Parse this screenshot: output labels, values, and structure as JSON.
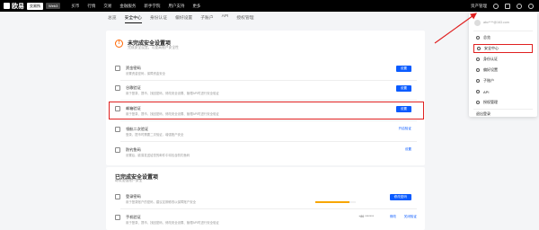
{
  "topbar": {
    "brand": "欧易",
    "pill_active": "交易所",
    "pill_inactive": "Web3",
    "nav": [
      "买币",
      "行情",
      "交易",
      "金融服务",
      "新手学院",
      "用户支持",
      "更多"
    ],
    "asset_label": "资产管理"
  },
  "tabs": [
    "总览",
    "安全中心",
    "身份认证",
    "偏好设置",
    "子账户",
    "API",
    "授权管理"
  ],
  "incomplete": {
    "title": "未完成安全设置项",
    "subtitle": "完成安全设置，可提高账户安全性",
    "items": [
      {
        "name": "资金密码",
        "desc": "设置资金密码，保障资金安全",
        "action": "设置"
      },
      {
        "name": "谷歌验证",
        "desc": "用于登录、提币、找回密码、修改安全设置、管理API时进行安全验证",
        "action": "设置"
      },
      {
        "name": "邮箱验证",
        "desc": "用于登录、提币、找回密码、修改安全设置、管理API时进行安全验证",
        "action": "设置"
      },
      {
        "name": "领航二次验证",
        "desc": "登录、提币时需要二次验证，增强账户安全",
        "action": "开启验证"
      },
      {
        "name": "防钓鱼码",
        "desc": "设置后，欧易发送给您的邮件中将包含防钓鱼码",
        "action": "设置"
      }
    ]
  },
  "complete": {
    "title": "已完成安全设置项",
    "subtitle": "继续加强账户安全",
    "items": [
      {
        "name": "登录密码",
        "desc": "用于登录账户的密码，建议定期修改以保障账户安全",
        "action": "修改密码",
        "progress": 0.85
      },
      {
        "name": "手机验证",
        "desc": "用于登录、提币、找回密码、修改安全设置、管理API时进行安全验证",
        "masked": "+86 *******",
        "action_a": "修改",
        "action_b": "关闭验证"
      }
    ]
  },
  "dropdown": {
    "username": "abc****@163.com",
    "items": [
      "总览",
      "安全中心",
      "身份认证",
      "偏好设置",
      "子账户",
      "API",
      "授权管理"
    ],
    "logout": "退出登录"
  },
  "colors": {
    "accent": "#0a5bff",
    "highlight": "#e02020",
    "warning": "#ff6600",
    "progress": "#f7a600"
  }
}
